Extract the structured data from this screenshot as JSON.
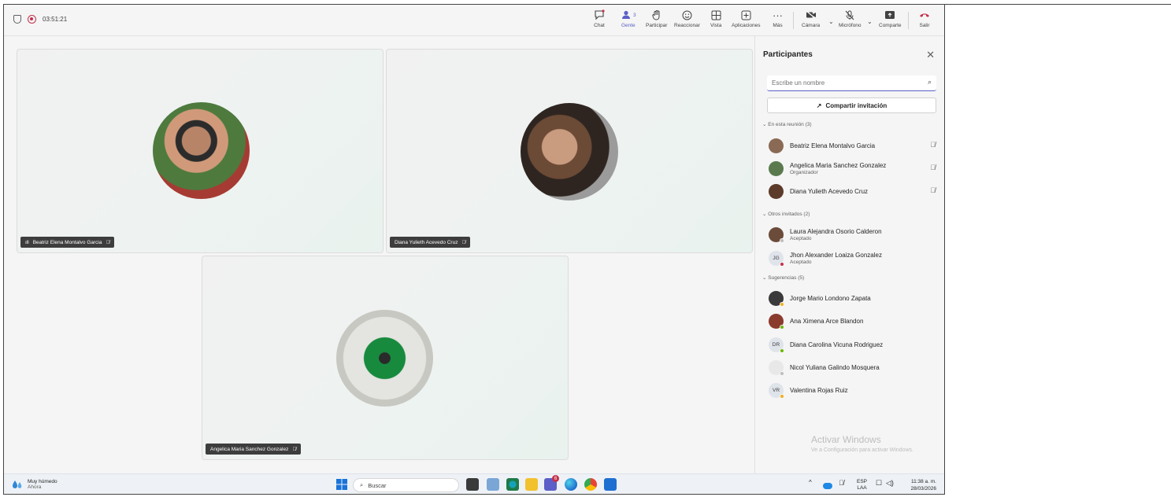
{
  "meeting": {
    "timer": "03:51:21"
  },
  "toolbar": {
    "chat": "Chat",
    "people": "Gente",
    "people_count": "3",
    "raise_hand": "Participar",
    "react": "Reaccionar",
    "view": "Vista",
    "apps": "Aplicaciones",
    "more": "Más",
    "camera": "Cámara",
    "mic": "Micrófono",
    "share": "Comparte",
    "leave": "Salir"
  },
  "tiles": [
    {
      "name": "Beatriz Elena Montalvo Garcia"
    },
    {
      "name": "Diana Yulieth Acevedo Cruz"
    },
    {
      "name": "Angelica Maria Sanchez Gonzalez"
    }
  ],
  "panel": {
    "title": "Participantes",
    "search_placeholder": "Escribe un nombre",
    "share_invite": "Compartir invitación",
    "section_in_meeting": "En esta reunión (3)",
    "section_others": "Otros invitados (2)",
    "section_suggestions": "Sugerencias (5)",
    "in_meeting": [
      {
        "name": "Beatriz Elena Montalvo Garcia",
        "sub": ""
      },
      {
        "name": "Angelica Maria Sanchez Gonzalez",
        "sub": "Organizador"
      },
      {
        "name": "Diana Yulieth Acevedo Cruz",
        "sub": ""
      }
    ],
    "others": [
      {
        "name": "Laura Alejandra Osorio Calderon",
        "sub": "Aceptado"
      },
      {
        "name": "Jhon Alexander Loaiza Gonzalez",
        "sub": "Aceptado",
        "initials": "JG"
      }
    ],
    "suggestions": [
      {
        "name": "Jorge Mario Londono Zapata"
      },
      {
        "name": "Ana Ximena Arce Blandon"
      },
      {
        "name": "Diana Carolina Vicuna Rodriguez",
        "initials": "DR"
      },
      {
        "name": "Nicol Yuliana Galindo Mosquera"
      },
      {
        "name": "Valentina Rojas Ruiz",
        "initials": "VR"
      }
    ]
  },
  "watermark": {
    "line1": "Activar Windows",
    "line2": "Ve a Configuración para activar Windows."
  },
  "taskbar": {
    "weather_title": "Muy húmedo",
    "weather_sub": "Ahora",
    "search": "Buscar",
    "teams_badge": "6",
    "lang_top": "ESP",
    "lang_bottom": "LAA",
    "time": "11:38 a. m.",
    "date": "28/03/2026"
  },
  "colors": {
    "accent": "#5b5fc7",
    "leave": "#c4314b",
    "recording": "#c4314b"
  }
}
